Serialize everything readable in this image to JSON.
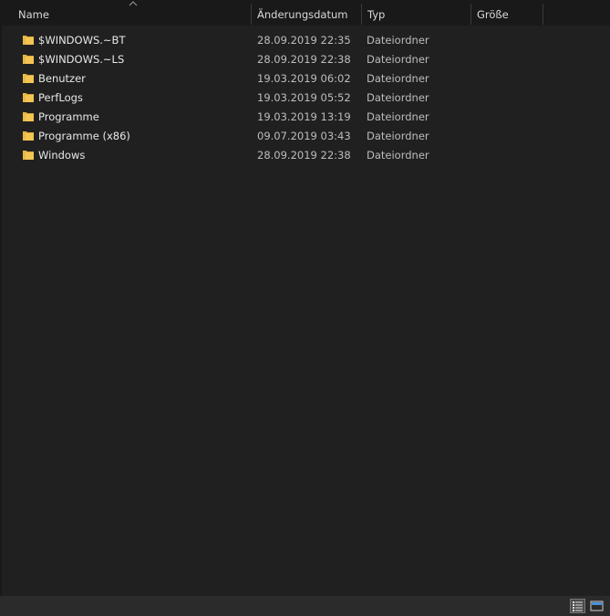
{
  "columns": {
    "name": "Name",
    "date": "Änderungsdatum",
    "type": "Typ",
    "size": "Größe"
  },
  "icons": {
    "folder": "folder-icon",
    "sort": "sort-ascending-icon",
    "details_view": "details-view-icon",
    "tiles_view": "large-icons-view-icon"
  },
  "colors": {
    "background": "#202020",
    "header_background": "#191919",
    "text": "#e8e8e8",
    "folder": "#f4c553"
  },
  "files": [
    {
      "name": "$WINDOWS.~BT",
      "date": "28.09.2019 22:35",
      "type": "Dateiordner",
      "size": ""
    },
    {
      "name": "$WINDOWS.~LS",
      "date": "28.09.2019 22:38",
      "type": "Dateiordner",
      "size": ""
    },
    {
      "name": "Benutzer",
      "date": "19.03.2019 06:02",
      "type": "Dateiordner",
      "size": ""
    },
    {
      "name": "PerfLogs",
      "date": "19.03.2019 05:52",
      "type": "Dateiordner",
      "size": ""
    },
    {
      "name": "Programme",
      "date": "19.03.2019 13:19",
      "type": "Dateiordner",
      "size": ""
    },
    {
      "name": "Programme (x86)",
      "date": "09.07.2019 03:43",
      "type": "Dateiordner",
      "size": ""
    },
    {
      "name": "Windows",
      "date": "28.09.2019 22:38",
      "type": "Dateiordner",
      "size": ""
    }
  ]
}
